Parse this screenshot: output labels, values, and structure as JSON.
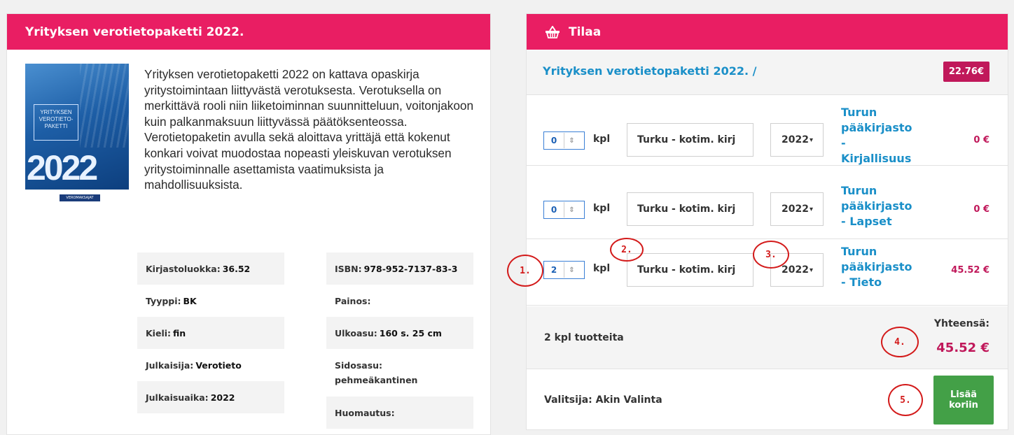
{
  "product": {
    "header_title": "Yrityksen verotietopaketti 2022.",
    "cover": {
      "label": "YRITYKSEN VEROTIETO-PAKETTI",
      "year": "2022",
      "publisher_mark": "VEROMAKSAJAT"
    },
    "description": "Yrityksen verotietopaketti 2022 on kattava opaskirja yritystoimintaan liittyvästä verotuksesta. Verotuksella on merkittävä rooli niin liiketoiminnan suunnitteluun, voitonjakoon kuin palkanmaksuun liittyvässä päätöksenteossa. Verotietopaketin avulla sekä aloittava yrittäjä että kokenut konkari voivat muodostaa nopeasti yleiskuvan verotuksen yritystoiminnalle asettamista vaatimuksista ja mahdollisuuksista.",
    "meta_left": [
      {
        "label": "Kirjastoluokka:",
        "value": "36.52"
      },
      {
        "label": "Tyyppi:",
        "value": "BK"
      },
      {
        "label": "Kieli:",
        "value": "fin"
      },
      {
        "label": "Julkaisija:",
        "value": "Verotieto"
      },
      {
        "label": "Julkaisuaika:",
        "value": "2022"
      }
    ],
    "meta_right": [
      {
        "label": "ISBN:",
        "value": "978-952-7137-83-3"
      },
      {
        "label": "Painos:",
        "value": ""
      },
      {
        "label": "Ulkoasu:",
        "value": "160 s. 25 cm"
      },
      {
        "label": "Sidosasu:",
        "value": "pehmeäkantinen"
      },
      {
        "label": "Huomautus:",
        "value": ""
      }
    ]
  },
  "order": {
    "header_title": "Tilaa",
    "title": "Yrityksen verotietopaketti 2022. /",
    "unit_price": "22.76€",
    "unit_label": "kpl",
    "lines": [
      {
        "qty": "0",
        "library_select": "Turku - kotim. kirj",
        "year_select": "2022",
        "library_name": [
          "Turun",
          "pääkirjasto",
          "-",
          "Kirjallisuus"
        ],
        "price": "0 €"
      },
      {
        "qty": "0",
        "library_select": "Turku - kotim. kirj",
        "year_select": "2022",
        "library_name": [
          "Turun",
          "pääkirjasto",
          "- Lapset"
        ],
        "price": "0 €"
      },
      {
        "qty": "2",
        "library_select": "Turku - kotim. kirj",
        "year_select": "2022",
        "library_name": [
          "Turun",
          "pääkirjasto",
          "- Tieto"
        ],
        "price": "45.52 €"
      }
    ],
    "summary_count": "2 kpl tuotteita",
    "total_label": "Yhteensä:",
    "total_value": "45.52 €",
    "selector": "Valitsija: Akin Valinta",
    "add_button_line1": "Lisää",
    "add_button_line2": "koriin"
  },
  "annotations": [
    "1.",
    "2.",
    "3.",
    "4.",
    "5."
  ],
  "colors": {
    "accent": "#e91e63",
    "price": "#c0185a",
    "link": "#1a8fc8",
    "button": "#43a047",
    "annotation": "#d31a1a"
  }
}
